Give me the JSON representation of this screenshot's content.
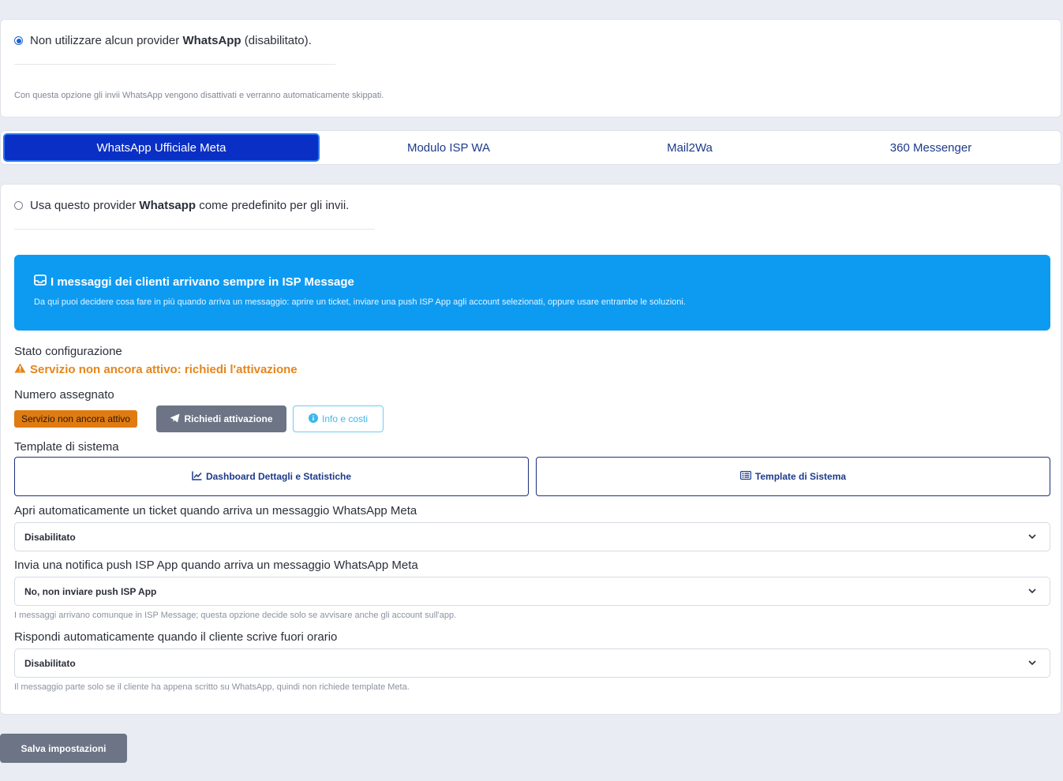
{
  "disable_card": {
    "radio_text_before": "Non utilizzare alcun provider ",
    "radio_text_bold": "WhatsApp",
    "radio_text_after": " (disabilitato).",
    "help": "Con questa opzione gli invii WhatsApp vengono disattivati e verranno automaticamente skippati.",
    "checked": true
  },
  "tabs": [
    {
      "label": "WhatsApp Ufficiale Meta",
      "active": true
    },
    {
      "label": "Modulo ISP WA",
      "active": false
    },
    {
      "label": "Mail2Wa",
      "active": false
    },
    {
      "label": "360 Messenger",
      "active": false
    }
  ],
  "provider": {
    "radio_text_before": "Usa questo provider ",
    "radio_text_bold": "Whatsapp",
    "radio_text_after": " come predefinito per gli invii.",
    "checked": false
  },
  "banner": {
    "title": "I messaggi dei clienti arrivano sempre in ISP Message",
    "text": "Da qui puoi decidere cosa fare in più quando arriva un messaggio: aprire un ticket, inviare una push ISP App agli account selezionati, oppure usare entrambe le soluzioni.",
    "icon": "inbox-icon"
  },
  "status": {
    "label": "Stato configurazione",
    "warning": "Servizio non ancora attivo: richiedi l'attivazione",
    "warning_icon": "warning-triangle-icon"
  },
  "number": {
    "label": "Numero assegnato",
    "badge": "Servizio non ancora attivo",
    "request_button": "Richiedi attivazione",
    "info_button": "Info e costi"
  },
  "templates": {
    "label": "Template di sistema",
    "dashboard_button": "Dashboard Dettagli e Statistiche",
    "template_button": "Template di Sistema"
  },
  "ticket": {
    "label": "Apri automaticamente un ticket quando arriva un messaggio WhatsApp Meta",
    "value": "Disabilitato"
  },
  "push": {
    "label": "Invia una notifica push ISP App quando arriva un messaggio WhatsApp Meta",
    "value": "No, non inviare push ISP App",
    "help": "I messaggi arrivano comunque in ISP Message; questa opzione decide solo se avvisare anche gli account sull'app."
  },
  "autoreply": {
    "label": "Rispondi automaticamente quando il cliente scrive fuori orario",
    "value": "Disabilitato",
    "help": "Il messaggio parte solo se il cliente ha appena scritto su WhatsApp, quindi non richiede template Meta."
  },
  "save_button": "Salva impostazioni",
  "colors": {
    "accent": "#0a2fc4",
    "banner": "#0d9bf2",
    "warning": "#e6851a",
    "badge": "#e07b12"
  }
}
